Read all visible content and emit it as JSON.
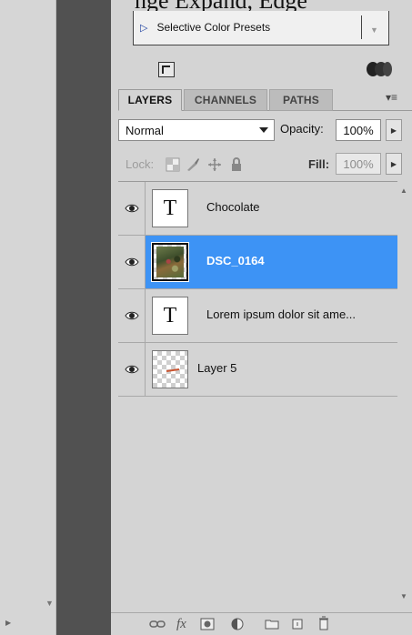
{
  "header": {
    "partial_text": "nge Expand, Edge",
    "preset_label": "Selective Color Presets"
  },
  "tabs": [
    {
      "label": "LAYERS"
    },
    {
      "label": "CHANNELS"
    },
    {
      "label": "PATHS"
    }
  ],
  "panel_menu_icon": "panel-menu-icon",
  "blend": {
    "mode": "Normal",
    "opacity_label": "Opacity:",
    "opacity_value": "100%"
  },
  "lock": {
    "label": "Lock:",
    "fill_label": "Fill:",
    "fill_value": "100%"
  },
  "layers": [
    {
      "name": "Chocolate",
      "type": "text",
      "selected": false,
      "visible": true
    },
    {
      "name": "DSC_0164",
      "type": "image",
      "selected": true,
      "visible": true
    },
    {
      "name": "Lorem ipsum dolor sit ame...",
      "type": "text",
      "selected": false,
      "visible": true
    },
    {
      "name": "Layer 5",
      "type": "raster",
      "selected": false,
      "visible": true
    }
  ],
  "thumb_text_glyph": "T",
  "colors": {
    "selected_row": "#3d93f5",
    "panel_bg": "#d4d4d4",
    "dark_column": "#515151"
  },
  "bottom_icons": [
    "link-layers-icon",
    "fx-icon",
    "add-mask-icon",
    "adjustment-layer-icon",
    "new-group-icon",
    "new-layer-icon",
    "trash-icon"
  ],
  "bottom_fx_label": "fx"
}
